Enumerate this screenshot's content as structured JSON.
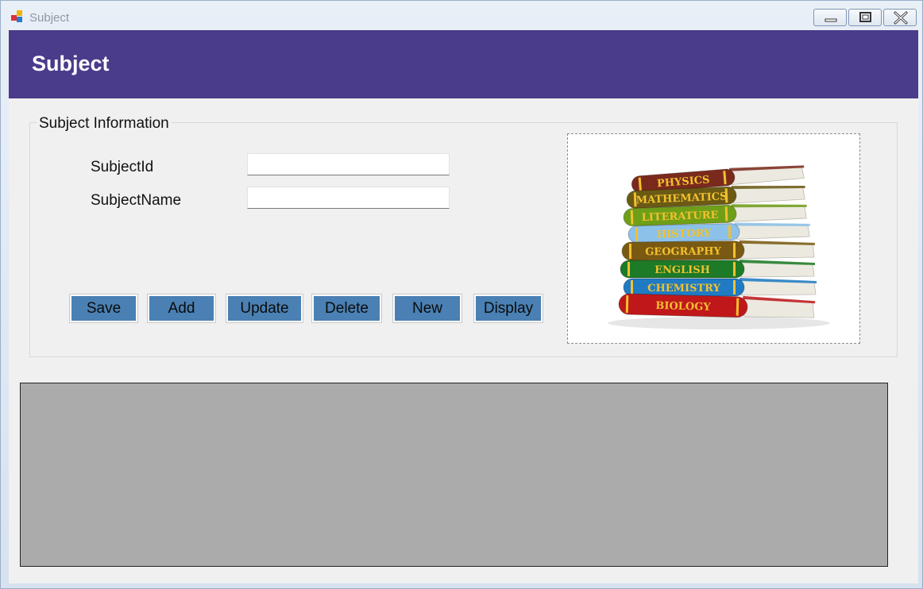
{
  "window": {
    "title": "Subject"
  },
  "header": {
    "title": "Subject"
  },
  "group": {
    "title": "Subject Information",
    "fields": [
      {
        "label": "SubjectId",
        "value": ""
      },
      {
        "label": "SubjectName",
        "value": ""
      }
    ]
  },
  "buttons": [
    {
      "label": "Save"
    },
    {
      "label": "Add"
    },
    {
      "label": "Update"
    },
    {
      "label": "Delete"
    },
    {
      "label": "New"
    },
    {
      "label": "Display"
    }
  ],
  "books": [
    {
      "title": "PHYSICS",
      "color": "#7a2a1c"
    },
    {
      "title": "MATHEMATICS",
      "color": "#6b5a14"
    },
    {
      "title": "LITERATURE",
      "color": "#6f9f18"
    },
    {
      "title": "HISTORY",
      "color": "#8cc2ea"
    },
    {
      "title": "GEOGRAPHY",
      "color": "#7a5a12"
    },
    {
      "title": "ENGLISH",
      "color": "#1d7a26"
    },
    {
      "title": "CHEMISTRY",
      "color": "#1f7bc4"
    },
    {
      "title": "BIOLOGY",
      "color": "#c0181a"
    }
  ],
  "colors": {
    "header_bg": "#4a3b8b",
    "button_bg": "#4a80b3",
    "grid_bg": "#ababab",
    "book_lettering": "#f2c12e"
  },
  "icons": {
    "app": "app-icon",
    "minimize": "minimize-icon",
    "maximize": "maximize-icon",
    "close": "close-icon"
  }
}
